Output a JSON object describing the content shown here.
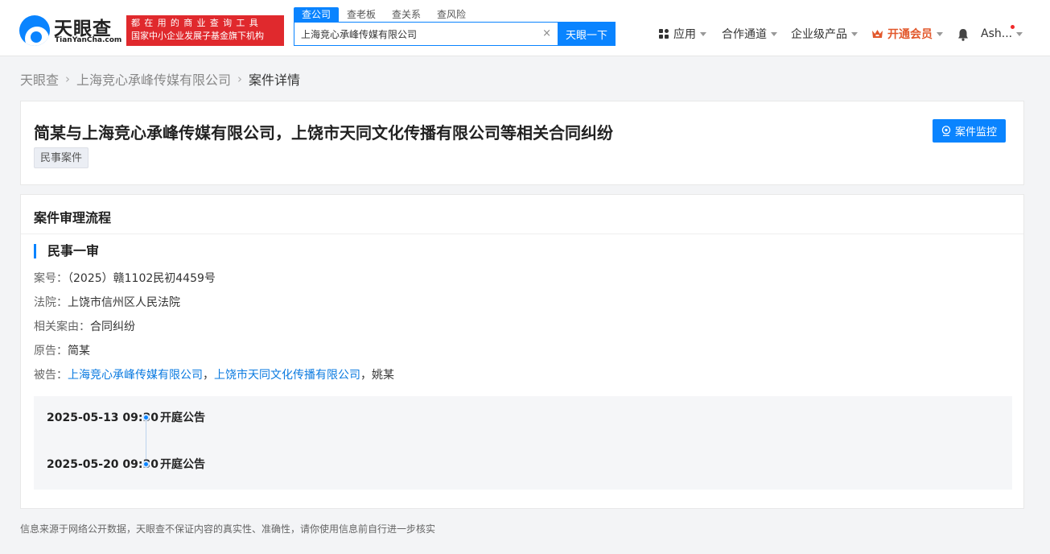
{
  "header": {
    "logo_cn": "天眼查",
    "logo_en": "TianYanCha.com",
    "slogan_line1": "都在用的商业查询工具",
    "slogan_line2": "国家中小企业发展子基金旗下机构",
    "search_tabs": [
      "查公司",
      "查老板",
      "查关系",
      "查风险"
    ],
    "search_value": "上海竞心承峰传媒有限公司",
    "search_button": "天眼一下",
    "nav": {
      "apps": "应用",
      "cooperation": "合作通道",
      "enterprise": "企业级产品",
      "vip": "开通会员",
      "user": "Ash..."
    },
    "colors": {
      "brand_blue": "#0a84ff",
      "slogan_red": "#e0292d",
      "vip_orange": "#e2582c"
    }
  },
  "breadcrumb": [
    "天眼查",
    "上海竞心承峰传媒有限公司",
    "案件详情"
  ],
  "case": {
    "title": "简某与上海竞心承峰传媒有限公司，上饶市天同文化传播有限公司等相关合同纠纷",
    "tag": "民事案件",
    "monitor_button": "案件监控"
  },
  "process": {
    "section_title": "案件审理流程",
    "stage": "民事一审",
    "case_no_label": "案号：",
    "case_no": "（2025）赣1102民初4459号",
    "court_label": "法院：",
    "court": "上饶市信州区人民法院",
    "cause_label": "相关案由：",
    "cause": "合同纠纷",
    "plaintiff_label": "原告：",
    "plaintiff": "简某",
    "defendant_label": "被告：",
    "defendants": [
      "上海竞心承峰传媒有限公司",
      "上饶市天同文化传播有限公司",
      "姚某"
    ],
    "separator": "，",
    "timeline": [
      {
        "date": "2025-05-13 09:30",
        "event": "开庭公告"
      },
      {
        "date": "2025-05-20 09:30",
        "event": "开庭公告"
      }
    ]
  },
  "footer_note": "信息来源于网络公开数据，天眼查不保证内容的真实性、准确性，请你使用信息前自行进一步核实"
}
